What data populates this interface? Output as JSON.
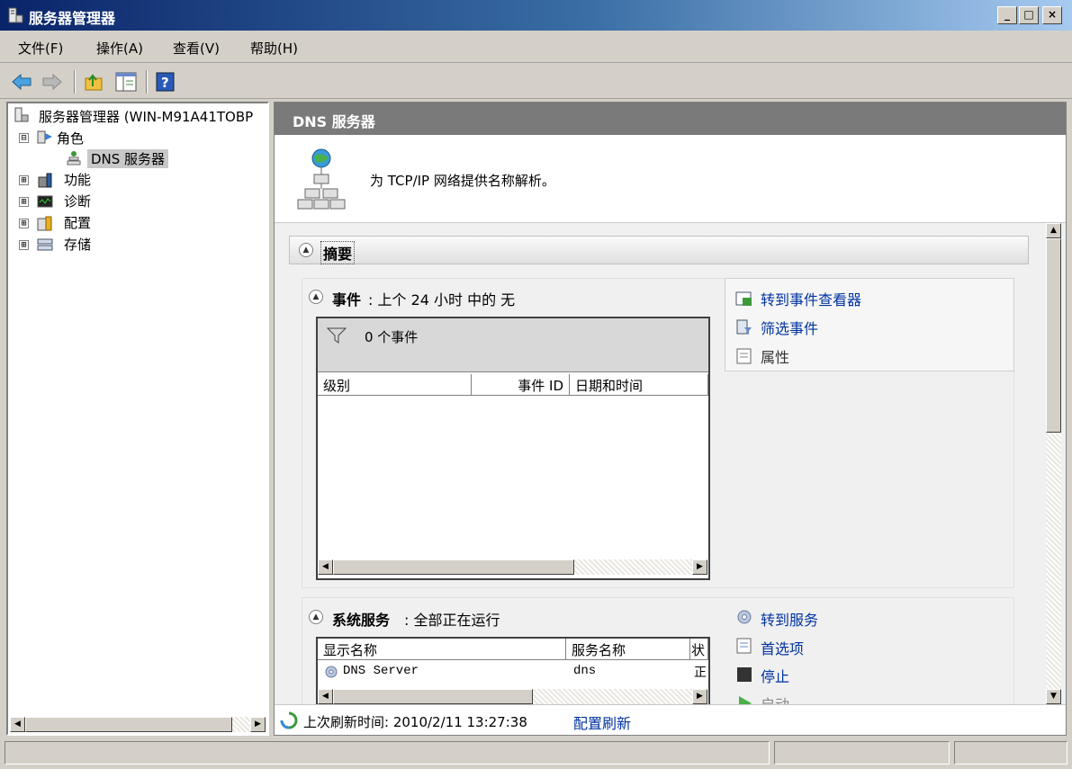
{
  "window": {
    "title": "服务器管理器",
    "buttons": {
      "minimize": "_",
      "restore": "□",
      "close": "×"
    }
  },
  "menu": [
    "文件(F)",
    "操作(A)",
    "查看(V)",
    "帮助(H)"
  ],
  "toolbar": {
    "icons": [
      "back-arrow-icon",
      "forward-arrow-icon",
      "up-folder-icon",
      "show-hide-tree-icon",
      "help-icon"
    ]
  },
  "tree": {
    "root": "服务器管理器 (WIN-M91A41TOBP",
    "roles": "角色",
    "dns": "DNS 服务器",
    "features": "功能",
    "diagnostics": "诊断",
    "configuration": "配置",
    "storage": "存储",
    "expanded_marker": "⊟",
    "collapsed_marker": "⊞"
  },
  "main": {
    "header": "DNS 服务器",
    "description": "为 TCP/IP 网络提供名称解析。",
    "summary": {
      "title": "摘要",
      "events": {
        "title": "事件",
        "subtitle": ": 上个 24 小时 中的 无",
        "filter_count": "0 个事件",
        "columns": [
          "级别",
          "事件 ID",
          "日期和时间"
        ],
        "actions": [
          "转到事件查看器",
          "筛选事件",
          "属性"
        ]
      },
      "services": {
        "title": "系统服务",
        "subtitle": ": 全部正在运行",
        "columns": [
          "显示名称",
          "服务名称",
          "状"
        ],
        "rows": [
          {
            "display_name": "DNS Server",
            "service_name": "dns",
            "status": "正"
          }
        ],
        "actions": [
          "转到服务",
          "首选项",
          "停止",
          "启动"
        ]
      }
    },
    "refresh": {
      "label": "上次刷新时间: 2010/2/11 13:27:38",
      "link": "配置刷新"
    }
  },
  "colors": {
    "title_gradient_start": "#0a246a",
    "title_gradient_end": "#a6caf0",
    "header_bg": "#7a7a7a",
    "link": "#0033a0",
    "chrome": "#d4d0c8"
  }
}
